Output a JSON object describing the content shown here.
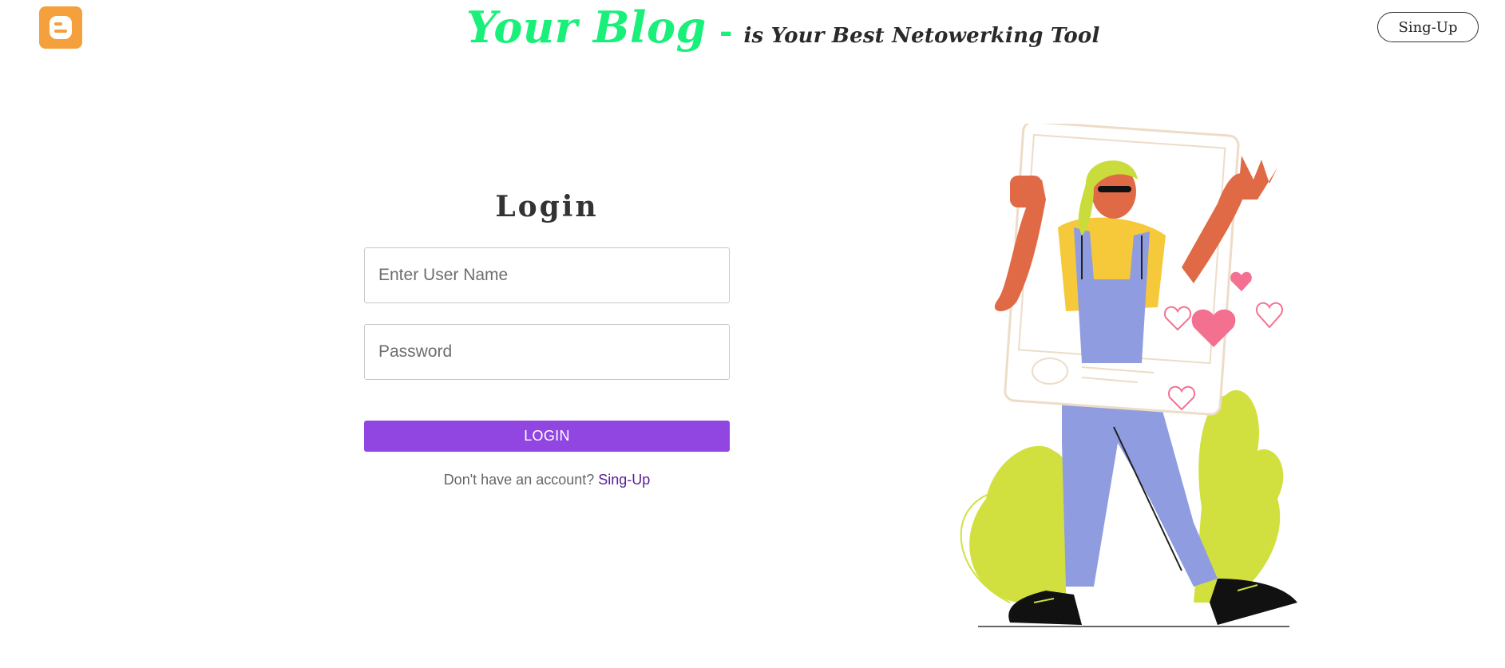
{
  "header": {
    "logo_icon": "blogger-logo-icon",
    "brand": "Your Blog",
    "dash": "-",
    "tagline": "is Your Best Netowerking Tool",
    "signup_label": "Sing-Up"
  },
  "login": {
    "heading": "Login",
    "username_placeholder": "Enter User Name",
    "username_value": "",
    "password_placeholder": "Password",
    "password_value": "",
    "submit_label": "LOGIN",
    "no_account_text": "Don't have an account?",
    "signup_link": "Sing-Up"
  },
  "illustration": {
    "icon": "woman-social-frame-illustration"
  },
  "colors": {
    "brand_green": "#19f07a",
    "logo_orange": "#f4a03c",
    "button_purple": "#9146e1",
    "link_purple": "#5b2198"
  }
}
